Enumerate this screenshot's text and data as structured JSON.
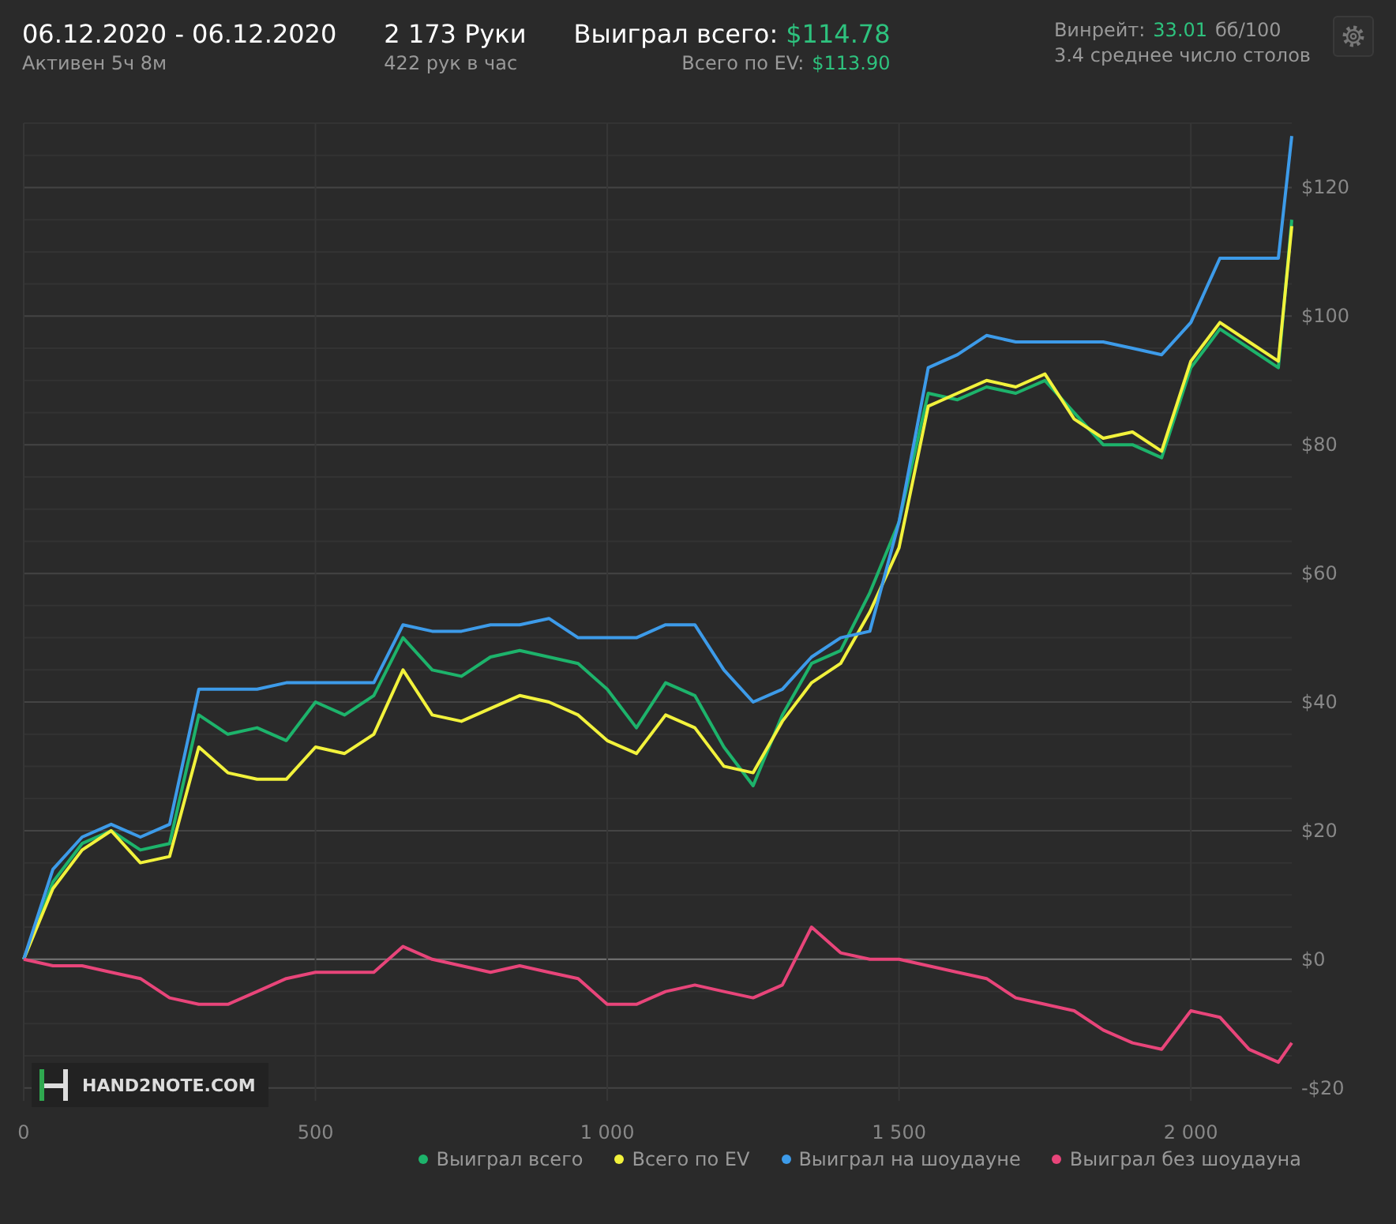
{
  "header": {
    "date_range": "06.12.2020 - 06.12.2020",
    "active_time": "Активен 5ч 8м",
    "hands": "2 173 Руки",
    "hands_per_hour": "422 рук в час",
    "won_label": "Выиграл всего:",
    "won_value": "$114.78",
    "ev_label": "Всего по EV:",
    "ev_value": "$113.90",
    "winrate_label": "Винрейт:",
    "winrate_value": "33.01",
    "winrate_unit": "бб/100",
    "tables": "3.4 среднее число столов"
  },
  "logo": "HAND2NOTE.COM",
  "chart": {
    "chart_data": {
      "type": "line",
      "x": [
        0,
        50,
        100,
        150,
        200,
        250,
        300,
        350,
        400,
        450,
        500,
        550,
        600,
        650,
        700,
        750,
        800,
        850,
        900,
        950,
        1000,
        1050,
        1100,
        1150,
        1200,
        1250,
        1300,
        1350,
        1400,
        1450,
        1500,
        1550,
        1600,
        1650,
        1700,
        1750,
        1800,
        1850,
        1900,
        1950,
        2000,
        2050,
        2100,
        2150,
        2173
      ],
      "series": [
        {
          "name": "Выиграл всего",
          "color": "#1db36b",
          "values": [
            0,
            12,
            18,
            20,
            17,
            18,
            38,
            35,
            36,
            34,
            40,
            38,
            41,
            50,
            45,
            44,
            47,
            48,
            47,
            46,
            42,
            36,
            43,
            41,
            33,
            27,
            38,
            46,
            48,
            57,
            68,
            88,
            87,
            89,
            88,
            90,
            85,
            80,
            80,
            78,
            92,
            98,
            95,
            92,
            115
          ]
        },
        {
          "name": "Всего по EV",
          "color": "#f2f23c",
          "values": [
            0,
            11,
            17,
            20,
            15,
            16,
            33,
            29,
            28,
            28,
            33,
            32,
            35,
            45,
            38,
            37,
            39,
            41,
            40,
            38,
            34,
            32,
            38,
            36,
            30,
            29,
            37,
            43,
            46,
            54,
            64,
            86,
            88,
            90,
            89,
            91,
            84,
            81,
            82,
            79,
            93,
            99,
            96,
            93,
            114
          ]
        },
        {
          "name": "Выиграл на шоудауне",
          "color": "#3d9be9",
          "values": [
            0,
            14,
            19,
            21,
            19,
            21,
            42,
            42,
            42,
            43,
            43,
            43,
            43,
            52,
            51,
            51,
            52,
            52,
            53,
            50,
            50,
            50,
            52,
            52,
            45,
            40,
            42,
            47,
            50,
            51,
            68,
            92,
            94,
            97,
            96,
            96,
            96,
            96,
            95,
            94,
            99,
            109,
            109,
            109,
            128
          ]
        },
        {
          "name": "Выиграл без шоудауна",
          "color": "#e8457a",
          "values": [
            0,
            -1,
            -1,
            -2,
            -3,
            -6,
            -7,
            -7,
            -5,
            -3,
            -2,
            -2,
            -2,
            2,
            0,
            -1,
            -2,
            -1,
            -2,
            -3,
            -7,
            -7,
            -5,
            -4,
            -5,
            -6,
            -4,
            5,
            1,
            0,
            0,
            -1,
            -2,
            -3,
            -6,
            -7,
            -8,
            -11,
            -13,
            -14,
            -8,
            -9,
            -14,
            -16,
            -13
          ]
        }
      ],
      "grid": true,
      "xlim": [
        0,
        2173
      ],
      "ylim": [
        -22,
        130
      ],
      "xticks": [
        0,
        500,
        {
          "value": 1000,
          "label": "1 000"
        },
        {
          "value": 1500,
          "label": "1 500"
        },
        {
          "value": 2000,
          "label": "2 000"
        }
      ],
      "yticks": [
        {
          "value": -20,
          "label": "-$20"
        },
        {
          "value": 0,
          "label": "$0"
        },
        {
          "value": 20,
          "label": "$20"
        },
        {
          "value": 40,
          "label": "$40"
        },
        {
          "value": 60,
          "label": "$60"
        },
        {
          "value": 80,
          "label": "$80"
        },
        {
          "value": 100,
          "label": "$100"
        },
        {
          "value": 120,
          "label": "$120"
        }
      ]
    }
  }
}
